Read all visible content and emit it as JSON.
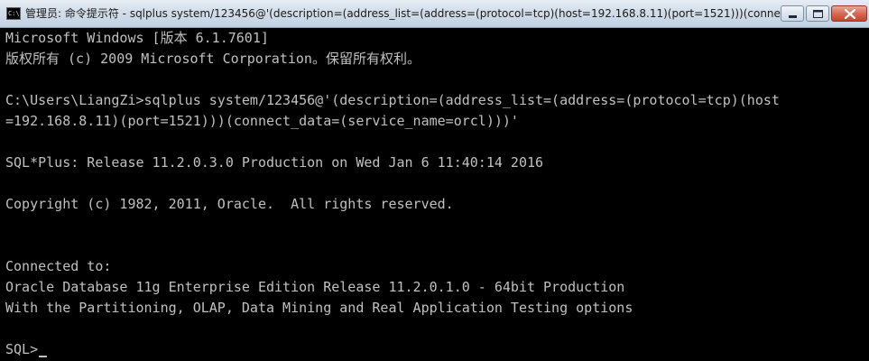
{
  "window": {
    "title": "管理员: 命令提示符 - sqlplus  system/123456@'(description=(address_list=(address=(protocol=tcp)(host=192.168.8.11)(port=1521)))(connect_dat...",
    "icon_label": "C:\\",
    "controls": [
      "minimize-icon",
      "maximize-icon",
      "close-icon"
    ]
  },
  "console": {
    "lines": [
      "Microsoft Windows [版本 6.1.7601]",
      "版权所有 (c) 2009 Microsoft Corporation。保留所有权利。",
      "",
      "C:\\Users\\LiangZi>sqlplus system/123456@'(description=(address_list=(address=(protocol=tcp)(host",
      "=192.168.8.11)(port=1521)))(connect_data=(service_name=orcl)))'",
      "",
      "SQL*Plus: Release 11.2.0.3.0 Production on Wed Jan 6 11:40:14 2016",
      "",
      "Copyright (c) 1982, 2011, Oracle.  All rights reserved.",
      "",
      "",
      "Connected to:",
      "Oracle Database 11g Enterprise Edition Release 11.2.0.1.0 - 64bit Production",
      "With the Partitioning, OLAP, Data Mining and Real Application Testing options",
      ""
    ],
    "prompt": "SQL>"
  },
  "colors": {
    "background": "#000000",
    "text": "#c0c0c0",
    "titlebar": "#d2dde9"
  }
}
